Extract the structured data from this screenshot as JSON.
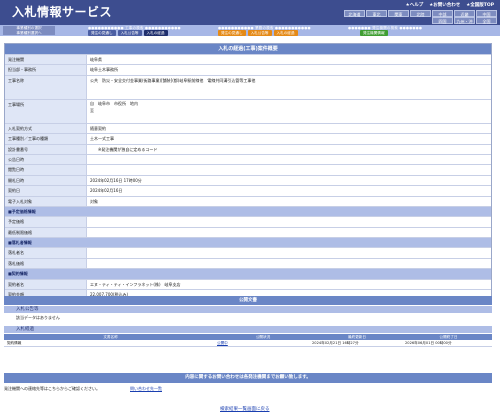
{
  "app": {
    "title": "入札情報サービス",
    "links": [
      "★ヘルプ",
      "★お問い合わせ",
      "★全国版TOP"
    ]
  },
  "regions": {
    "row1": [
      "北海道",
      "東北",
      "関東",
      "北陸",
      "中部",
      "近畿",
      "中国"
    ],
    "row2": [
      "四国",
      "九州・沖縄",
      "全国"
    ]
  },
  "nav": {
    "left_title": [
      "事業種別の選択",
      "事業種別選択へ"
    ],
    "groups": [
      {
        "title": "工事の検索",
        "tabs": [
          "発注の見通し",
          "入札公告等",
          "入札の経過"
        ]
      },
      {
        "title": "業務の検索",
        "tabs": [
          "発注の見通し",
          "入札公告等",
          "入札の経過"
        ]
      },
      {
        "title": "発注機関の検索",
        "tabs": [
          "発注機関情報"
        ]
      }
    ]
  },
  "detail": {
    "heading": "入札の経過(工事)案件概要",
    "rows": [
      {
        "label": "発注機関",
        "value": "岐阜県"
      },
      {
        "label": "担当部・事務所",
        "value": "岐阜土木事務所"
      },
      {
        "label": "工事名称",
        "value": "公共　防災・安全交付金事業(街路事業)[舗装](都)岐阜駅前線他　電線共同溝引込管等工事他"
      },
      {
        "label": "工事場所",
        "value": [
          "自　岐阜市　市役所　地内",
          "至"
        ]
      },
      {
        "label": "入札契約方式",
        "value": "随意契約"
      },
      {
        "label": "工事種別／工事の種類",
        "value": "土木一式工事"
      },
      {
        "label": "設計書番号",
        "value": "　　※発注機関が独自に定めるコード"
      },
      {
        "label": "公告日時",
        "value": ""
      },
      {
        "label": "閲覧日時",
        "value": ""
      },
      {
        "label": "開札日時",
        "value": "2024年02月16日 17時00分"
      },
      {
        "label": "契約日",
        "value": "2024年02月16日"
      },
      {
        "label": "電子入札対象",
        "value": "対象"
      }
    ],
    "section_estimate": "■予定価格情報",
    "rows_estimate": [
      {
        "label": "予定価格",
        "value": ""
      },
      {
        "label": "最低制限価格",
        "value": ""
      }
    ],
    "section_winner": "■落札者情報",
    "rows_winner": [
      {
        "label": "落札者名",
        "value": ""
      },
      {
        "label": "落札価格",
        "value": ""
      }
    ],
    "section_contract": "■契約情報",
    "rows_contract": [
      {
        "label": "契約者名",
        "value": "エヌ・ティ・ティ・インフラネット(株)　岐阜支店"
      },
      {
        "label": "契約金額",
        "value": "22,007,700(税込み)"
      }
    ]
  },
  "public_docs": {
    "heading": "公開文書",
    "notice_sub": "入札公告等",
    "notice_empty": "該当データはありません",
    "result_sub": "入札経過",
    "columns": [
      "文書名称",
      "公開状況",
      "最終更新日",
      "公開終了日"
    ],
    "rows": [
      {
        "name": "契約情報",
        "status": "公開中",
        "updated": "2024年02月21日 16時27分",
        "end": "2026年06月01日 00時00分"
      }
    ]
  },
  "footer": {
    "notice": "内容に関するお問い合わせは各発注機関までお願い致します。",
    "contact_text": "発注機関への連絡先等はこちらからご確認ください。",
    "contact_link": "問い合わせ先一覧",
    "back_link": "検索結果一覧画面に戻る"
  }
}
